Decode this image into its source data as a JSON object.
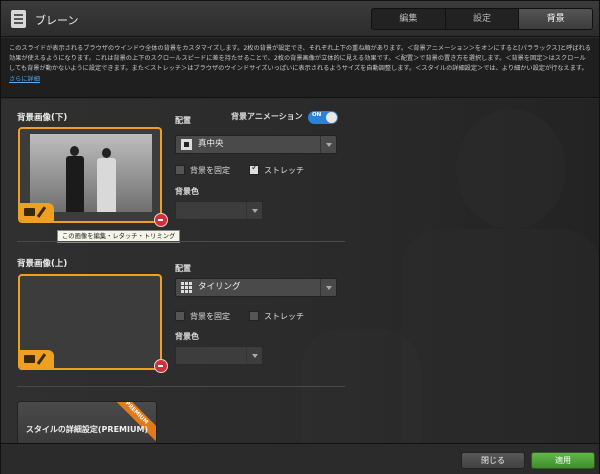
{
  "header": {
    "title": "ブレーン",
    "icon": "document-icon",
    "tabs": [
      {
        "label": "編集",
        "active": false
      },
      {
        "label": "設定",
        "active": false
      },
      {
        "label": "背景",
        "active": true
      }
    ]
  },
  "description": {
    "text": "このスライドが表示されるブラウザのウインドウ全体の背景をカスタマイズします。2枚の背景が設定でき、それぞれ上下の重ね順があります。＜背景アニメーション＞をオンにすると[パララックス]と呼ばれる効果が使えるようになります。これは背景の上下のスクロールスピードに差を持たせることで、2枚の背景画像が立体的に見える効果です。＜配置＞で背景の置き方を選択します。＜背景を固定＞はスクロールしても背景が動かないように設定できます。また＜ストレッチ＞はブラウザのウインドサイズいっぱいに表示されるようサイズを自動調整します。＜スタイルの詳細設定＞では、より細かい設定が行なえます。",
    "link": "さらに詳細"
  },
  "lower_bg": {
    "label": "背景画像(下)",
    "placement_label": "配置",
    "placement_value": "真中央",
    "fixed_label": "背景を固定",
    "fixed_checked": false,
    "stretch_label": "ストレッチ",
    "stretch_checked": true,
    "color_label": "背景色",
    "tooltip": "この画像を編集・レタッチ・トリミング"
  },
  "animation": {
    "label": "背景アニメーション",
    "state": "ON"
  },
  "upper_bg": {
    "label": "背景画像(上)",
    "placement_label": "配置",
    "placement_value": "タイリング",
    "fixed_label": "背景を固定",
    "fixed_checked": false,
    "stretch_label": "ストレッチ",
    "stretch_checked": false,
    "color_label": "背景色"
  },
  "premium": {
    "label": "スタイルの詳細設定(PREMIUM)",
    "badge": "PREMIUM"
  },
  "footer": {
    "close_label": "閉じる",
    "apply_label": "適用"
  },
  "colors": {
    "accent_orange": "#f0a020",
    "toggle_blue": "#2b82d6",
    "apply_green": "#4aa035",
    "delete_red": "#d0303a"
  }
}
